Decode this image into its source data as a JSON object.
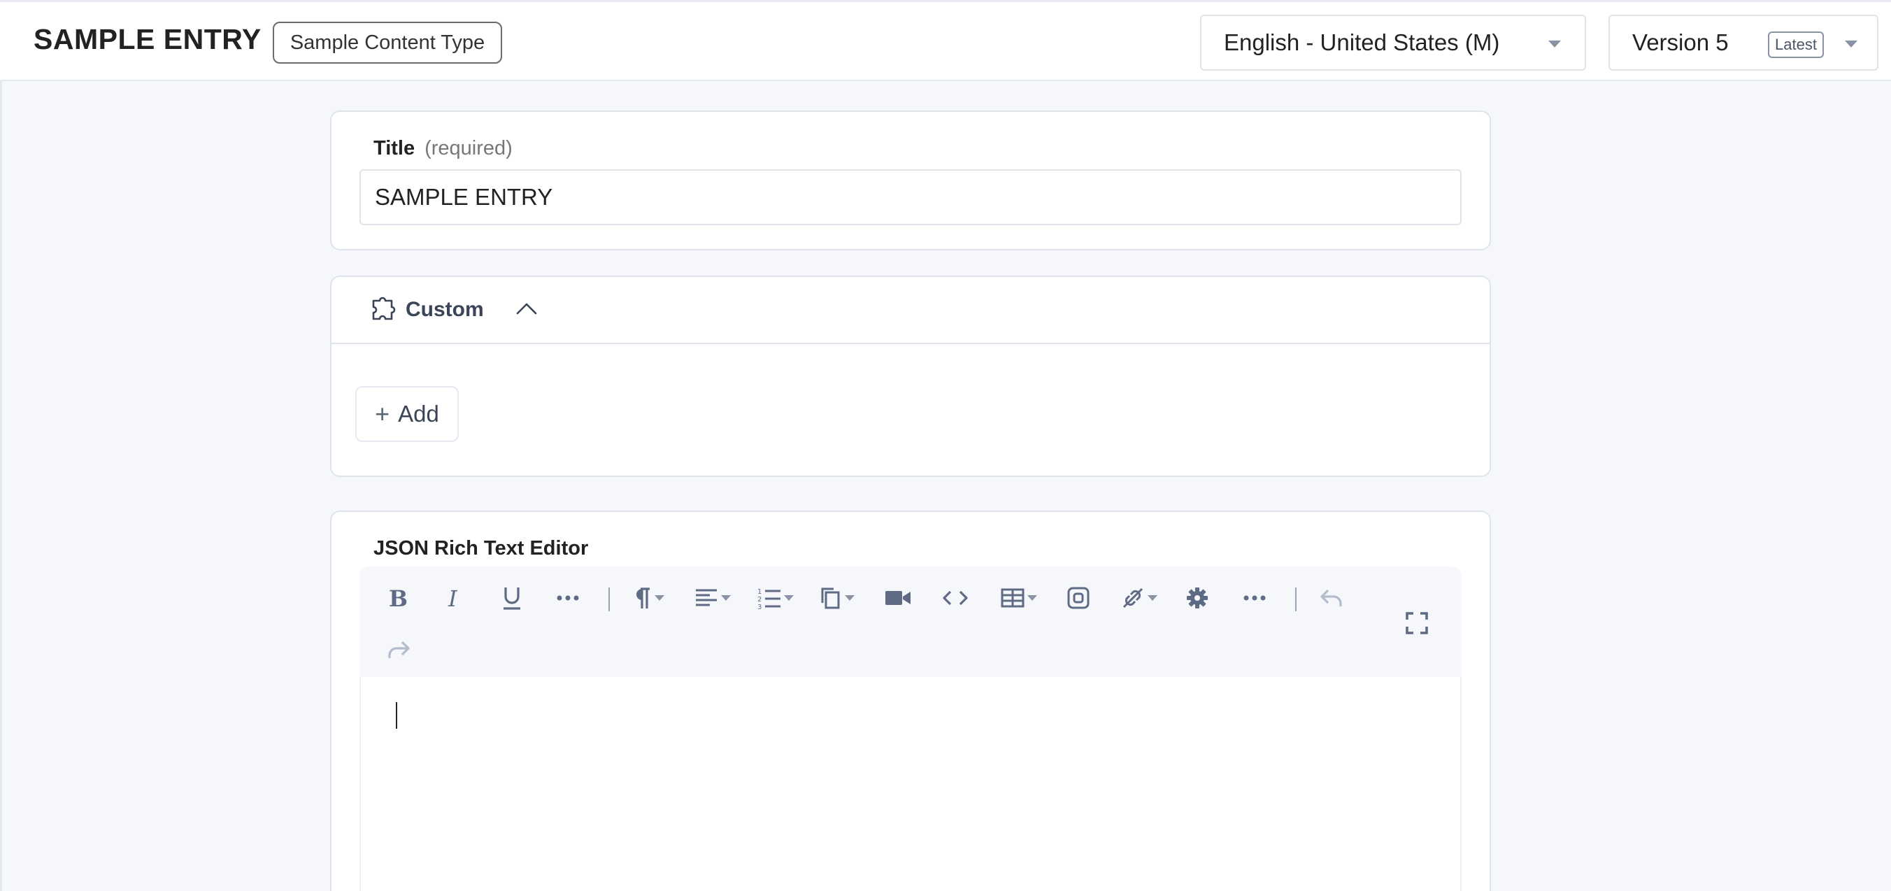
{
  "header": {
    "entry_title": "SAMPLE ENTRY",
    "content_type": "Sample Content Type",
    "locale": "English - United States (M)",
    "version": "Version 5",
    "version_badge": "Latest"
  },
  "title_field": {
    "label": "Title",
    "hint": "(required)",
    "value": "SAMPLE ENTRY"
  },
  "custom_group": {
    "label": "Custom",
    "add_label": "Add"
  },
  "rte": {
    "label": "JSON Rich Text Editor",
    "toolbar": [
      "bold-icon",
      "italic-icon",
      "underline-icon",
      "more-formatting-icon",
      "paragraph-icon",
      "align-icon",
      "ordered-list-icon",
      "copy-icon",
      "video-icon",
      "code-icon",
      "table-icon",
      "embed-icon",
      "link-icon",
      "settings-gear-icon",
      "more-icon",
      "undo-icon",
      "redo-icon",
      "fullscreen-icon"
    ]
  },
  "colors": {
    "background": "#f5f7fb",
    "card_border": "#dfe4ec",
    "toolbar_icon": "#5f6b85"
  }
}
